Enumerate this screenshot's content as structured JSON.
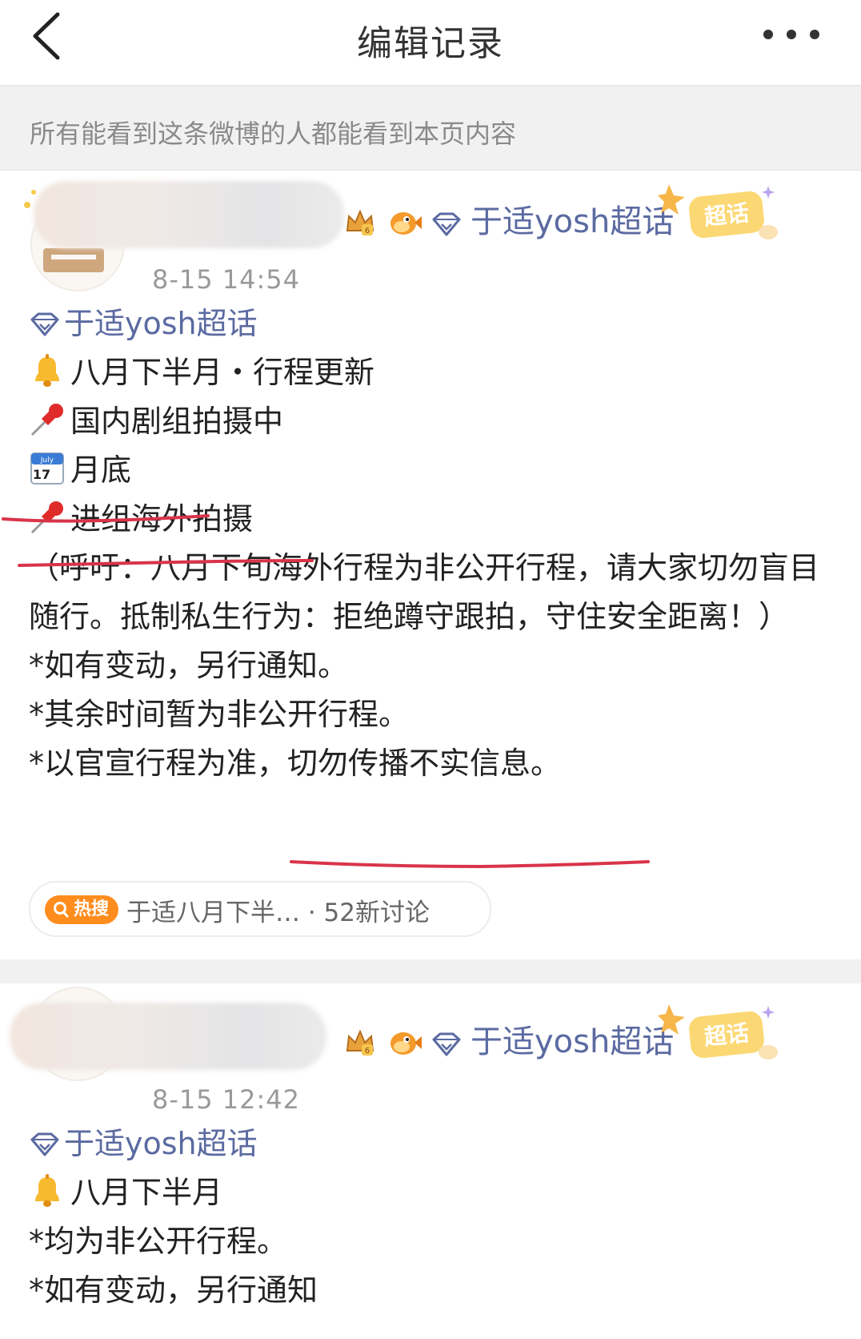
{
  "nav": {
    "title": "编辑记录",
    "back_icon": "chevron-left-icon",
    "more_icon": "more-dots-icon"
  },
  "notice": {
    "text": "所有能看到这条微博的人都能看到本页内容"
  },
  "posts": [
    {
      "time": "8-15 14:54",
      "topic": "于适yosh超话",
      "badge": "超话",
      "content_topic": "于适yosh超话",
      "lines": [
        "八月下半月・行程更新",
        "国内剧组拍摄中",
        "月底",
        "进组海外拍摄",
        "（呼吁：八月下旬海外行程为非公开行程，请大家切勿盲目随行。抵制私生行为：拒绝蹲守跟拍，守住安全距离！）",
        "*如有变动，另行通知。",
        "*其余时间暂为非公开行程。",
        "*以官宣行程为准，切勿传播不实信息。"
      ],
      "hot": {
        "tag": "热搜",
        "text": "于适八月下半…  ·  52新讨论"
      }
    },
    {
      "time": "8-15 12:42",
      "topic": "于适yosh超话",
      "badge": "超话",
      "content_topic": "于适yosh超话",
      "lines": [
        "八月下半月",
        "*均为非公开行程。",
        "*如有变动，另行通知"
      ]
    }
  ],
  "colors": {
    "topic": "#5b6aa1",
    "underline": "#d9344a",
    "hot_tag": "#ff8d1e"
  }
}
